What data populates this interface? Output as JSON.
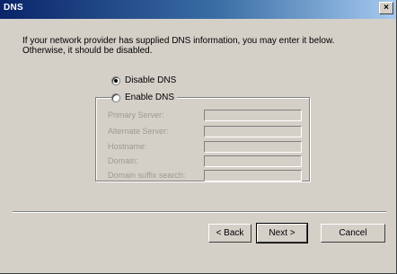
{
  "window": {
    "title": "DNS",
    "close_glyph": "×"
  },
  "intro": {
    "text": "If your network provider has supplied DNS information, you may enter it below. Otherwise, it should be disabled."
  },
  "options": {
    "disable_label": "Disable DNS",
    "enable_label": "Enable DNS",
    "selected": "disable"
  },
  "fields": [
    {
      "label": "Primary Server:",
      "value": ""
    },
    {
      "label": "Alternate Server:",
      "value": ""
    },
    {
      "label": "Hostname:",
      "value": ""
    },
    {
      "label": "Domain:",
      "value": ""
    },
    {
      "label": "Domain suffix search:",
      "value": ""
    }
  ],
  "buttons": {
    "back": "< Back",
    "next": "Next >",
    "cancel": "Cancel"
  }
}
